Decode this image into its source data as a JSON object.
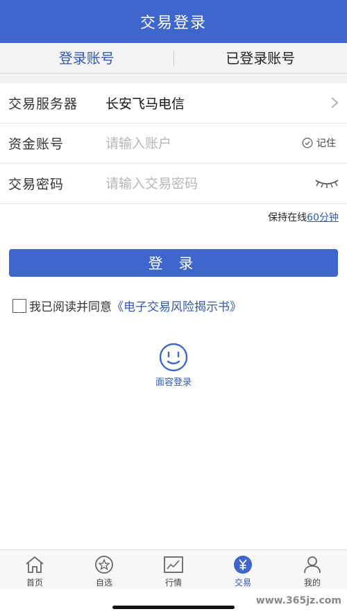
{
  "header": {
    "title": "交易登录"
  },
  "tabs": [
    {
      "label": "登录账号",
      "active": true
    },
    {
      "label": "已登录账号",
      "active": false
    }
  ],
  "form": {
    "server": {
      "label": "交易服务器",
      "value": "长安飞马电信"
    },
    "account": {
      "label": "资金账号",
      "placeholder": "请输入账户",
      "value": "",
      "remember_label": "记住"
    },
    "password": {
      "label": "交易密码",
      "placeholder": "请输入交易密码",
      "value": ""
    }
  },
  "online": {
    "prefix": "保持在线",
    "duration": "60分钟"
  },
  "login_button": {
    "label": "登 录"
  },
  "agreement": {
    "text": "我已阅读并同意",
    "link": "《电子交易风险揭示书》",
    "checked": false
  },
  "face_login": {
    "label": "面容登录"
  },
  "tabbar": [
    {
      "label": "首页",
      "icon": "home-icon"
    },
    {
      "label": "自选",
      "icon": "star-icon"
    },
    {
      "label": "行情",
      "icon": "chart-icon"
    },
    {
      "label": "交易",
      "icon": "yen-icon",
      "active": true
    },
    {
      "label": "我的",
      "icon": "person-icon"
    }
  ],
  "watermark": "www.365jz.com",
  "colors": {
    "primary": "#3e66cc",
    "link": "#2f58b8",
    "background": "#ffffff"
  }
}
